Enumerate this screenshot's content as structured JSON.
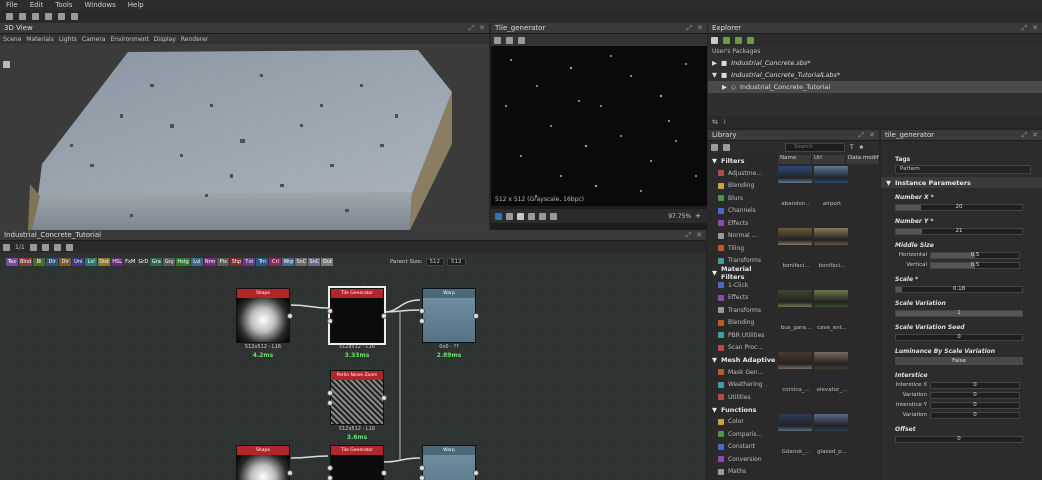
{
  "menu": [
    "File",
    "Edit",
    "Tools",
    "Windows",
    "Help"
  ],
  "view3d": {
    "title": "3D View",
    "menu": [
      "Scene",
      "Materials",
      "Lights",
      "Camera",
      "Environment",
      "Display",
      "Renderer"
    ]
  },
  "tile_generator": {
    "title": "Tile_generator",
    "status": "512 x 512 (Grayscale, 16bpc)",
    "zoom": "97.75%"
  },
  "explorer": {
    "title": "Explorer",
    "section": "User's Packages",
    "items": [
      "Industrial_Concrete.sbs*",
      "Industrial_Concrete_TutorialLabs*",
      "Industrial_Concrete_Tutorial"
    ]
  },
  "library": {
    "title": "Library",
    "search_placeholder": "Search",
    "columns": [
      "Name",
      "Url",
      "Data modif"
    ],
    "categories": [
      {
        "name": "Filters",
        "items": [
          "Adjustme...",
          "Blending",
          "Blurs",
          "Channels",
          "Effects",
          "Normal ...",
          "Tiling",
          "Transforms"
        ]
      },
      {
        "name": "Material Filters",
        "items": [
          "1-Click",
          "Effects",
          "Transforms",
          "Blending",
          "PBR Utilities",
          "Scan Proc..."
        ]
      },
      {
        "name": "Mesh Adaptive",
        "items": [
          "Mask Gen...",
          "Weathering",
          "Utilities"
        ]
      },
      {
        "name": "Functions",
        "items": [
          "Color",
          "Comparis...",
          "Constant",
          "Conversion",
          "Maths"
        ]
      }
    ],
    "thumbs": [
      [
        "abandon...",
        "airport"
      ],
      [
        "bonifaci...",
        "bonifaci..."
      ],
      [
        "bus_gara...",
        "cave_ent..."
      ],
      [
        "corsica_...",
        "elevator_..."
      ],
      [
        "Gdansk_...",
        "glazed_p..."
      ]
    ]
  },
  "props": {
    "title": "tile_generator",
    "tags_label": "Tags",
    "tags_value": "Pattern",
    "section": "Instance Parameters",
    "params": [
      {
        "label": "Number X *",
        "value": "20",
        "fill": 0.2
      },
      {
        "label": "Number Y *",
        "value": "21",
        "fill": 0.21
      }
    ],
    "middle_size": {
      "label": "Middle Size",
      "h_label": "Horizontal",
      "h_value": "0.5",
      "v_label": "Vertical",
      "v_value": "0.5"
    },
    "scale": {
      "label": "Scale *",
      "value": "0.18"
    },
    "scale_variation": {
      "label": "Scale Variation",
      "value": "1"
    },
    "scale_variation_seed": {
      "label": "Scale Variation Seed",
      "value": "0"
    },
    "lum_by_scale": {
      "label": "Luminance By Scale Variation",
      "value": "False"
    },
    "interstice": {
      "label": "Interstice",
      "rows": [
        {
          "label": "Interstice X",
          "value": "0"
        },
        {
          "label": "Variation",
          "value": "0"
        },
        {
          "label": "Interstice Y",
          "value": "0"
        },
        {
          "label": "Variation",
          "value": "0"
        }
      ]
    },
    "offset": {
      "label": "Offset",
      "value": "0"
    }
  },
  "graph": {
    "title": "Industrial_Concrete_Tutorial",
    "toolbar_zoom": "1/1",
    "parent_size_label": "Parent Size:",
    "parent_size_value": "512",
    "size_value": "512",
    "chips": [
      {
        "t": "Tex",
        "c": "#7a4b9a"
      },
      {
        "t": "Blnd",
        "c": "#8a3a3a"
      },
      {
        "t": "Bl",
        "c": "#4a6a2a"
      },
      {
        "t": "Dir",
        "c": "#2a5a7a"
      },
      {
        "t": "Dir",
        "c": "#7a5a2a"
      },
      {
        "t": "Uni",
        "c": "#3a3a8a"
      },
      {
        "t": "Lvl",
        "c": "#2a7a6a"
      },
      {
        "t": "Dist",
        "c": "#8a7a2a"
      },
      {
        "t": "HSL",
        "c": "#6a2a7a"
      },
      {
        "t": "FxM",
        "c": "#3a3a3a"
      },
      {
        "t": "GrD",
        "c": "#3a3a3a"
      },
      {
        "t": "Gra",
        "c": "#2a6a4a"
      },
      {
        "t": "Gry",
        "c": "#5a5a5a"
      },
      {
        "t": "Hstg",
        "c": "#2a7a2a"
      },
      {
        "t": "Lvl",
        "c": "#3a6a8a"
      },
      {
        "t": "Nrm",
        "c": "#7a2a7a"
      },
      {
        "t": "Pix",
        "c": "#5a5a5a"
      },
      {
        "t": "Shp",
        "c": "#8a2a2a"
      },
      {
        "t": "Txt",
        "c": "#6a3a8a"
      },
      {
        "t": "Trn",
        "c": "#2a5a8a"
      },
      {
        "t": "Crl",
        "c": "#8a2a5a"
      },
      {
        "t": "Wrp",
        "c": "#4a6a8a"
      },
      {
        "t": "SnC",
        "c": "#6a6a6a"
      },
      {
        "t": "SnC",
        "c": "#6a6a8a"
      },
      {
        "t": "Out",
        "c": "#7a7a7a"
      }
    ],
    "nodes": [
      {
        "id": "shape",
        "header": "Shape",
        "hc": "#b2262b",
        "info": "512x512 - L16",
        "time": "4.2ms"
      },
      {
        "id": "tilegen",
        "header": "Tile Generator",
        "hc": "#b2262b",
        "info": "512x512 - L16",
        "time": "3.33ms"
      },
      {
        "id": "warp",
        "header": "Warp",
        "hc": "#4a6a7a",
        "info": "0x0 - ??",
        "time": "2.89ms"
      },
      {
        "id": "perlin",
        "header": "Perlin Noise Zoom",
        "hc": "#b2262b",
        "info": "512x512 - L16",
        "time": "3.6ms"
      },
      {
        "id": "shape2",
        "header": "Shape",
        "hc": "#b2262b",
        "info": "",
        "time": ""
      },
      {
        "id": "tilegen2",
        "header": "Tile Generator",
        "hc": "#b2262b",
        "info": "",
        "time": ""
      },
      {
        "id": "warp2",
        "header": "Warp",
        "hc": "#4a6a7a",
        "info": "",
        "time": ""
      }
    ]
  }
}
